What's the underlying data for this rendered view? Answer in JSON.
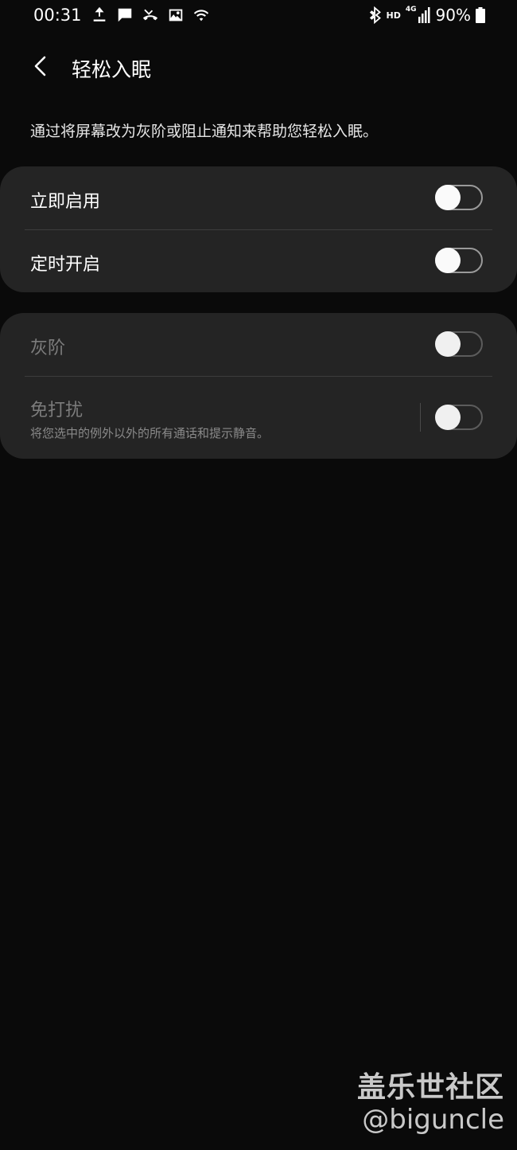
{
  "status_bar": {
    "time": "00:31",
    "network_hd": "HD",
    "network_type": "4G",
    "battery": "90%",
    "icons_left": [
      "upload-icon",
      "message-icon",
      "missed-call-icon",
      "image-icon",
      "wifi-icon"
    ],
    "icons_right": [
      "bluetooth-icon",
      "signal-icon",
      "battery-icon"
    ]
  },
  "header": {
    "title": "轻松入眠"
  },
  "description": "通过将屏幕改为灰阶或阻止通知来帮助您轻松入眠。",
  "card1": {
    "rows": [
      {
        "label": "立即启用",
        "on": false
      },
      {
        "label": "定时开启",
        "on": false
      }
    ]
  },
  "card2": {
    "rows": [
      {
        "label": "灰阶",
        "on": false,
        "enabled": false
      },
      {
        "label": "免打扰",
        "subtitle": "将您选中的例外以外的所有通话和提示静音。",
        "on": false,
        "enabled": false
      }
    ]
  },
  "watermark": {
    "name": "盖乐世社区",
    "handle": "@biguncle"
  },
  "colors": {
    "background": "#0a0a0a",
    "card": "#242424",
    "disabled_text": "#7c7c7c"
  }
}
